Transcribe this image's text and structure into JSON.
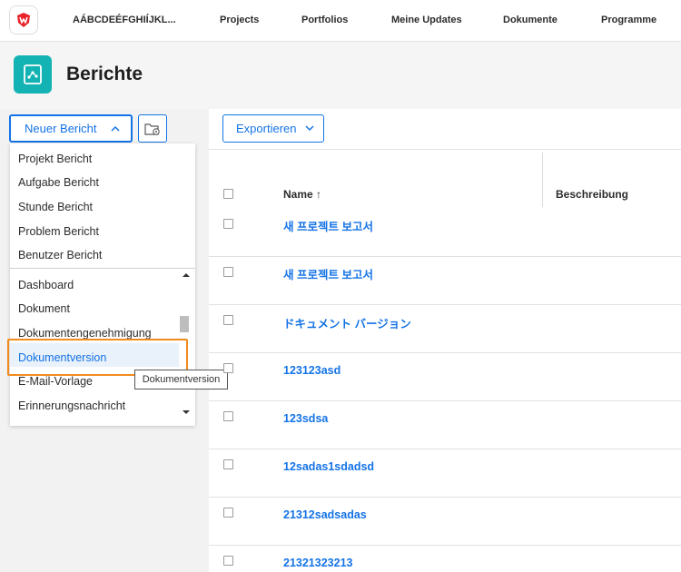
{
  "nav": {
    "org_name": "AÁBCDEÉFGHIÍJKL...",
    "items": [
      "Projects",
      "Portfolios",
      "Meine Updates",
      "Dokumente",
      "Programme"
    ]
  },
  "page": {
    "title": "Berichte"
  },
  "left": {
    "new_report_label": "Neuer Bericht",
    "dropdown": {
      "top_items": [
        "Projekt Bericht",
        "Aufgabe Bericht",
        "Stunde Bericht",
        "Problem Bericht",
        "Benutzer Bericht"
      ],
      "list_items": [
        "Dashboard",
        "Dokument",
        "Dokumentengenehmigung",
        "Dokumentversion",
        "E-Mail-Vorlage",
        "Erinnerungsnachricht"
      ],
      "highlighted": "Dokumentversion"
    },
    "tooltip": "Dokumentversion"
  },
  "toolbar": {
    "export_label": "Exportieren"
  },
  "table": {
    "columns": {
      "name": "Name",
      "name_sort": "↑",
      "description": "Beschreibung"
    },
    "rows": [
      "새 프로젝트 보고서",
      "새 프로젝트 보고서",
      "ドキュメント バージョン",
      "123123asd",
      "123sdsa",
      "12sadas1sdadsd",
      "21312sadsadas",
      "21321323213"
    ]
  },
  "colors": {
    "accent": "#1473e6",
    "brand_teal": "#14b3b3",
    "focus": "#f28b1e",
    "logo_red": "#e8232a"
  }
}
